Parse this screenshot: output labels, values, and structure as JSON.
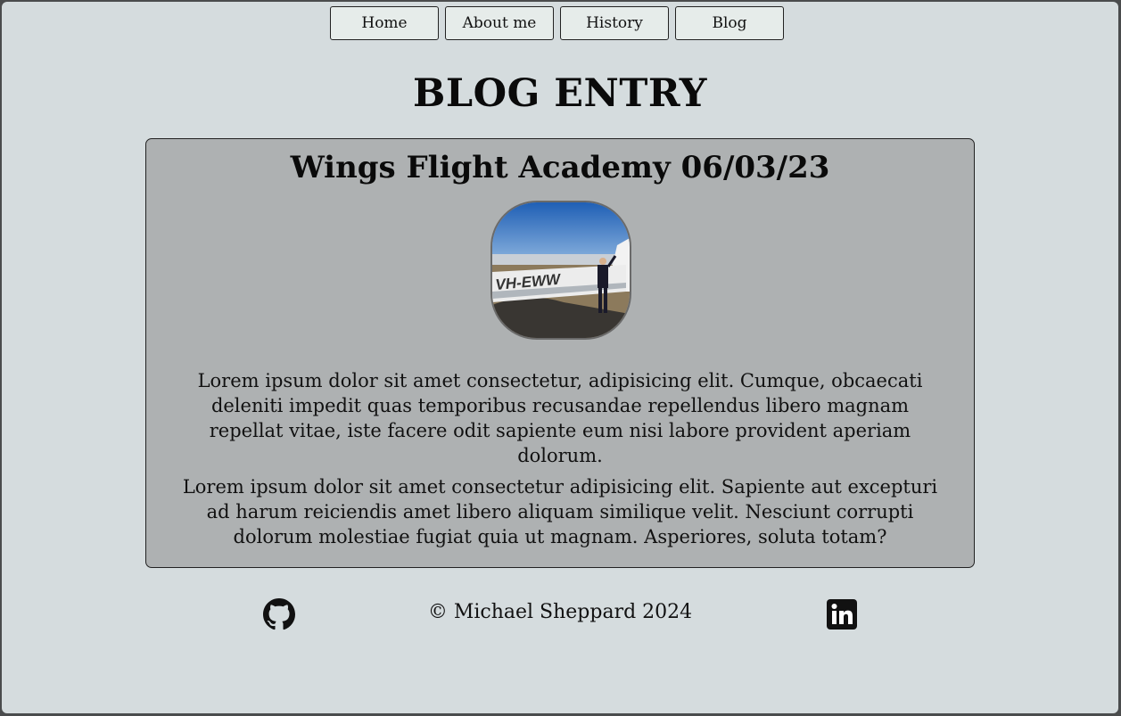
{
  "nav": {
    "items": [
      {
        "label": "Home"
      },
      {
        "label": "About me"
      },
      {
        "label": "History"
      },
      {
        "label": "Blog"
      }
    ]
  },
  "page": {
    "title": "BLOG ENTRY"
  },
  "entry": {
    "title": "Wings Flight Academy 06/03/23",
    "photo_registration": "VH-EWW",
    "paragraphs": [
      "Lorem ipsum dolor sit amet consectetur, adipisicing elit. Cumque, obcaecati deleniti impedit quas temporibus recusandae repellendus libero magnam repellat vitae, iste facere odit sapiente eum nisi labore provident aperiam dolorum.",
      "Lorem ipsum dolor sit amet consectetur adipisicing elit. Sapiente aut excepturi ad harum reiciendis amet libero aliquam similique velit. Nesciunt corrupti dolorum molestiae fugiat quia ut magnam. Asperiores, soluta totam?"
    ]
  },
  "footer": {
    "copyright": "© Michael Sheppard 2024",
    "icons": [
      "github-icon",
      "linkedin-icon"
    ]
  },
  "colors": {
    "page_background": "#d5dcde",
    "card_background": "#aeb1b2",
    "button_background": "#e6ecea",
    "text": "#0a0a0a"
  }
}
